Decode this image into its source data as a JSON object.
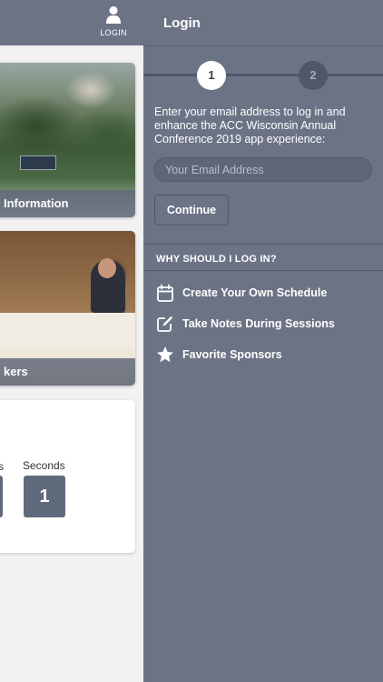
{
  "header": {
    "login_label": "LOGIN"
  },
  "cards": [
    {
      "label": "Information"
    },
    {
      "label": "kers"
    }
  ],
  "countdown": {
    "colon": ":",
    "partial_label": "s",
    "seconds_label": "Seconds",
    "seconds_value": "1"
  },
  "drawer": {
    "title": "Login",
    "steps": [
      "1",
      "2"
    ],
    "intro": "Enter your email address to log in and enhance the ACC Wisconsin Annual Conference 2019 app experience:",
    "email_placeholder": "Your Email Address",
    "continue_label": "Continue",
    "why_heading": "WHY SHOULD I LOG IN?",
    "benefits": [
      {
        "icon": "calendar-icon",
        "label": "Create Your Own Schedule"
      },
      {
        "icon": "edit-note-icon",
        "label": "Take Notes During Sessions"
      },
      {
        "icon": "star-icon",
        "label": "Favorite Sponsors"
      }
    ]
  },
  "colors": {
    "drawer_bg": "#6b7385",
    "header_bg": "#6b7385",
    "divider": "#555d6e",
    "step_active_bg": "#ffffff",
    "step_inactive_bg": "#4f5769",
    "timer_box": "#606a7d"
  }
}
